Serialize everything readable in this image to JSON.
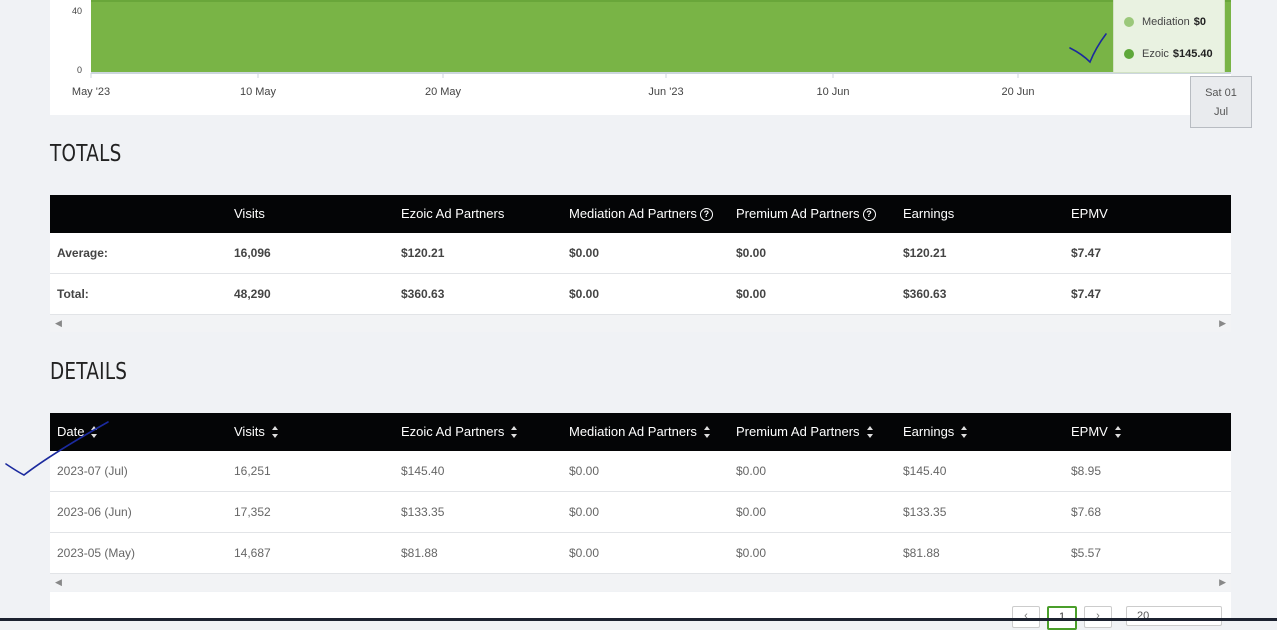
{
  "chart": {
    "y_ticks": [
      "40",
      "0"
    ],
    "x_ticks": [
      "May '23",
      "10 May",
      "20 May",
      "Jun '23",
      "10 Jun",
      "20 Jun"
    ],
    "tooltip": {
      "rows": [
        {
          "label": "Mediation",
          "value": "$0",
          "color": "#9bc87a"
        },
        {
          "label": "Ezoic",
          "value": "$145.40",
          "color": "#5ea83a"
        }
      ]
    },
    "date_popup": {
      "line1": "Sat 01",
      "line2": "Jul"
    },
    "area_color": "#79b446"
  },
  "chart_data": {
    "type": "area",
    "x": [
      "May '23",
      "10 May",
      "20 May",
      "Jun '23",
      "10 Jun",
      "20 Jun",
      "Sat 01 Jul"
    ],
    "series": [
      {
        "name": "Ezoic",
        "values": [
          120.21,
          120.21,
          120.21,
          120.21,
          120.21,
          120.21,
          145.4
        ]
      },
      {
        "name": "Mediation",
        "values": [
          0,
          0,
          0,
          0,
          0,
          0,
          0
        ]
      }
    ],
    "ylim": [
      0,
      40
    ],
    "grid": false
  },
  "totals": {
    "title": "TOTALS",
    "headers": [
      "",
      "Visits",
      "Ezoic Ad Partners",
      "Mediation Ad Partners",
      "Premium Ad Partners",
      "Earnings",
      "EPMV"
    ],
    "rows": [
      [
        "Average:",
        "16,096",
        "$120.21",
        "$0.00",
        "$0.00",
        "$120.21",
        "$7.47"
      ],
      [
        "Total:",
        "48,290",
        "$360.63",
        "$0.00",
        "$0.00",
        "$360.63",
        "$7.47"
      ]
    ]
  },
  "details": {
    "title": "DETAILS",
    "headers": [
      "Date",
      "Visits",
      "Ezoic Ad Partners",
      "Mediation Ad Partners",
      "Premium Ad Partners",
      "Earnings",
      "EPMV"
    ],
    "rows": [
      [
        "2023-07 (Jul)",
        "16,251",
        "$145.40",
        "$0.00",
        "$0.00",
        "$145.40",
        "$8.95"
      ],
      [
        "2023-06 (Jun)",
        "17,352",
        "$133.35",
        "$0.00",
        "$0.00",
        "$133.35",
        "$7.68"
      ],
      [
        "2023-05 (May)",
        "14,687",
        "$81.88",
        "$0.00",
        "$0.00",
        "$81.88",
        "$5.57"
      ]
    ]
  },
  "pagination": {
    "prev": "‹",
    "current": "1",
    "next": "›",
    "page_size": "20"
  },
  "scroll": {
    "left": "◀",
    "right": "▶"
  }
}
